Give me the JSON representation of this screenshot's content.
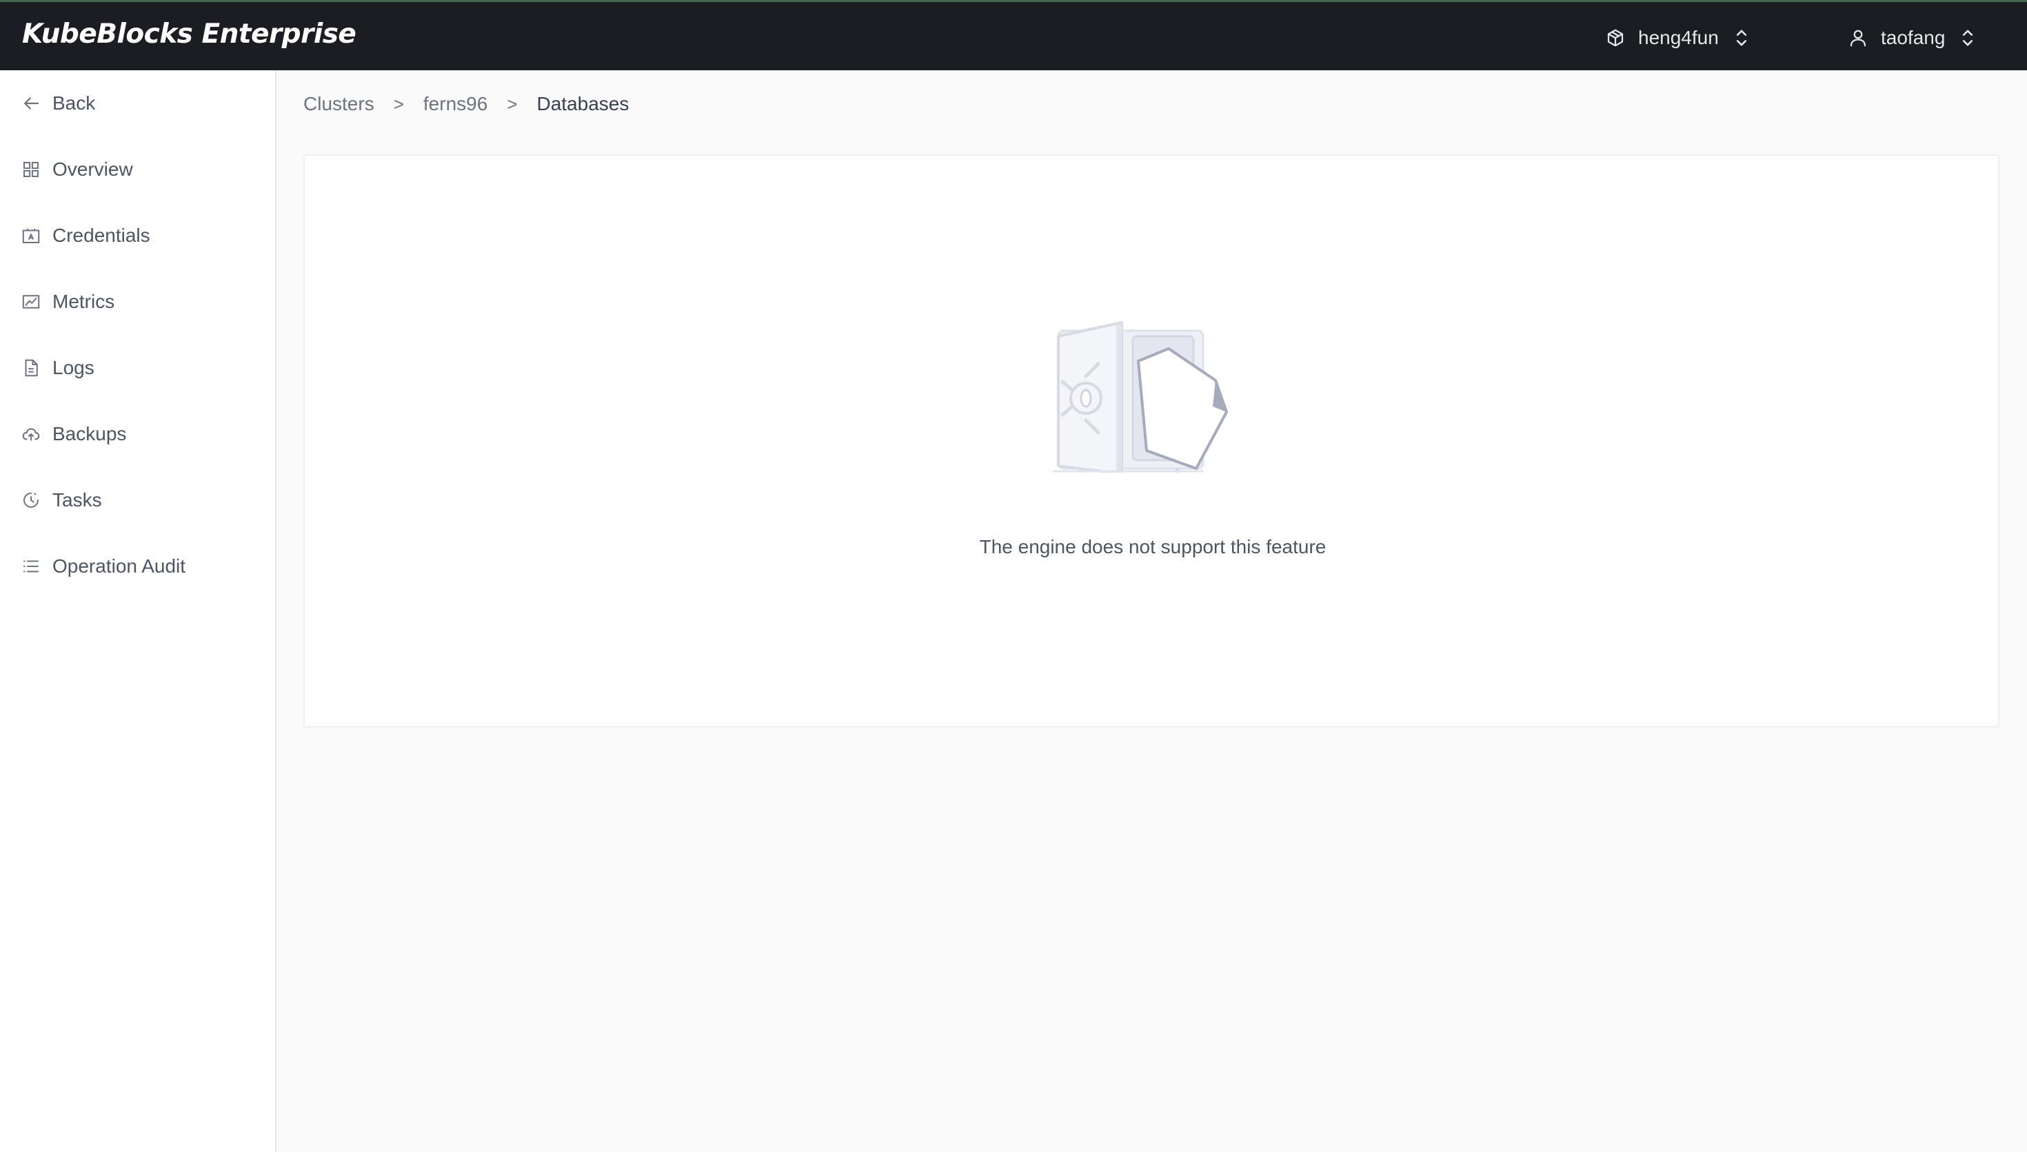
{
  "app": {
    "brand": "KubeBlocks Enterprise"
  },
  "header": {
    "org_selector": {
      "label": "heng4fun",
      "icon": "org-cube-icon"
    },
    "user_selector": {
      "label": "taofang",
      "icon": "user-icon"
    }
  },
  "sidebar": {
    "items": [
      {
        "label": "Back",
        "icon": "arrow-left-icon"
      },
      {
        "label": "Overview",
        "icon": "grid-icon"
      },
      {
        "label": "Credentials",
        "icon": "id-card-icon"
      },
      {
        "label": "Metrics",
        "icon": "line-chart-icon"
      },
      {
        "label": "Logs",
        "icon": "document-icon"
      },
      {
        "label": "Backups",
        "icon": "cloud-upload-icon"
      },
      {
        "label": "Tasks",
        "icon": "clock-icon"
      },
      {
        "label": "Operation Audit",
        "icon": "list-icon"
      }
    ]
  },
  "breadcrumb": {
    "items": [
      "Clusters",
      "ferns96",
      "Databases"
    ],
    "separator": ">"
  },
  "main": {
    "empty_state": {
      "icon": "empty-safe-icon",
      "message": "The engine does not support this feature"
    }
  },
  "colors": {
    "topbar_bg": "#1b1d22",
    "page_bg": "#fafafa",
    "panel_bg": "#ffffff"
  }
}
